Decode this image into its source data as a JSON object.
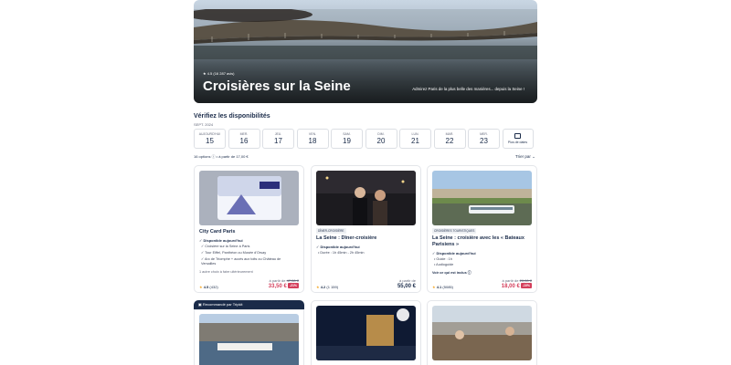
{
  "hero": {
    "rating": "★ 4.5 (16 287 avis)",
    "title": "Croisières sur la Seine",
    "tagline": "Admirez Paris de la plus belle des manières... depuis la Seine !"
  },
  "availability": {
    "title": "Vérifiez les disponibilités",
    "month": "SEPT. 2024",
    "dates": [
      {
        "dow": "AUJOURD'HUI",
        "day": "15"
      },
      {
        "dow": "MER.",
        "day": "16"
      },
      {
        "dow": "JEU.",
        "day": "17"
      },
      {
        "dow": "VEN.",
        "day": "18"
      },
      {
        "dow": "SAM.",
        "day": "19"
      },
      {
        "dow": "DIM.",
        "day": "20"
      },
      {
        "dow": "LUN.",
        "day": "21"
      },
      {
        "dow": "MAR.",
        "day": "22"
      },
      {
        "dow": "MER.",
        "day": "23"
      }
    ],
    "more_dates": "Plus de dates"
  },
  "results": {
    "options": "16 options ⓘ • à partir de 17,00 €",
    "sort": "Trier par ⌄"
  },
  "cards": [
    {
      "title": "City Card Paris",
      "avail": "✓ Disponible aujourd'hui",
      "features": [
        "✓ Croisière sur la Seine à Paris",
        "✓ Tour Eiffel, Panthéon ou Musée d'Orsay",
        "✓ Arc de Triomphe + accès aux toits ou Château de Versailles"
      ],
      "note": "1 autre choix à faire ultérieurement",
      "score": "4.5",
      "reviews": "(432)",
      "from": "à partir de",
      "old_price": "47,50 €",
      "price": "33,50 €",
      "discount": "-21%"
    },
    {
      "tag": "DÎNER-CROISIÈRE",
      "title": "La Seine : Dîner-croisière",
      "avail": "✓ Disponible aujourd'hui",
      "features": [
        "• Durée : 1h 45min - 2h 45min"
      ],
      "score": "4.2",
      "reviews": "(1 159)",
      "from": "à partir de",
      "price": "55,00 €"
    },
    {
      "tag": "CROISIÈRES TOURISTIQUES",
      "title": "La Seine : croisière avec les « Bateaux Parisiens »",
      "avail": "✓ Disponible aujourd'hui",
      "features": [
        "• Guide : 1h",
        "• Audioguide"
      ],
      "link": "Voir ce qui est inclus ⓘ",
      "score": "4.1",
      "reviews": "(5085)",
      "from": "à partir de",
      "old_price": "20,00 €",
      "price": "18,00 €",
      "discount": "-10%"
    }
  ],
  "recommended": "Recommandé par Tripkit",
  "paris_card": {
    "line1": "PARIS",
    "line2": "DIGITAL PASS"
  },
  "colors": {
    "navy": "#1a2b49",
    "red": "#d43f5c",
    "star": "#f5a623"
  }
}
